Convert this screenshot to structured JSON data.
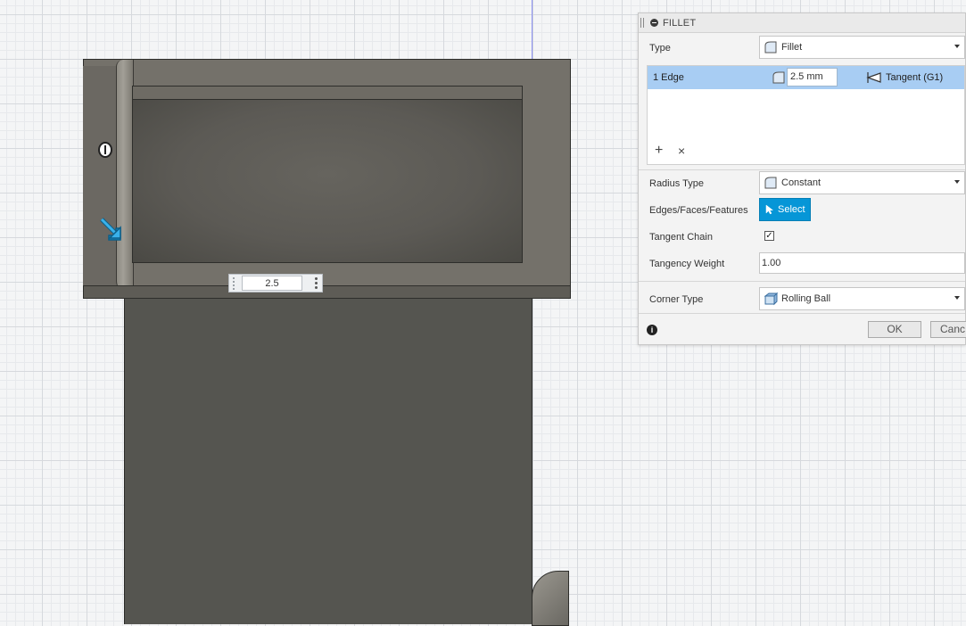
{
  "panel": {
    "title": "FILLET",
    "type": {
      "label": "Type",
      "value": "Fillet"
    },
    "edges": [
      {
        "name": "1 Edge",
        "radius": "2.5 mm",
        "continuity": "Tangent (G1)"
      }
    ],
    "radius_type": {
      "label": "Radius Type",
      "value": "Constant"
    },
    "edges_faces_features": {
      "label": "Edges/Faces/Features",
      "button": "Select"
    },
    "tangent_chain": {
      "label": "Tangent Chain",
      "checked": true,
      "mark": "✓"
    },
    "tangency_weight": {
      "label": "Tangency Weight",
      "value": "1.00"
    },
    "corner_type": {
      "label": "Corner Type",
      "value": "Rolling Ball"
    },
    "ok_label": "OK",
    "cancel_label": "Canc",
    "add_glyph": "+",
    "remove_glyph": "×",
    "info_glyph": "i"
  },
  "viewport": {
    "radius_input_value": "2.5"
  },
  "colors": {
    "accent": "#0696d7",
    "selected_row": "#a8cdf3",
    "model": "#74716a"
  },
  "icons": [
    "collapse-icon",
    "fillet-type-icon",
    "caret-down-icon",
    "tangent-icon",
    "add-icon",
    "remove-icon",
    "cursor-icon",
    "corner-rolling-ball-icon",
    "info-icon",
    "grip-icon",
    "kebab-menu-icon",
    "drag-arrow-icon",
    "handle-icon"
  ]
}
